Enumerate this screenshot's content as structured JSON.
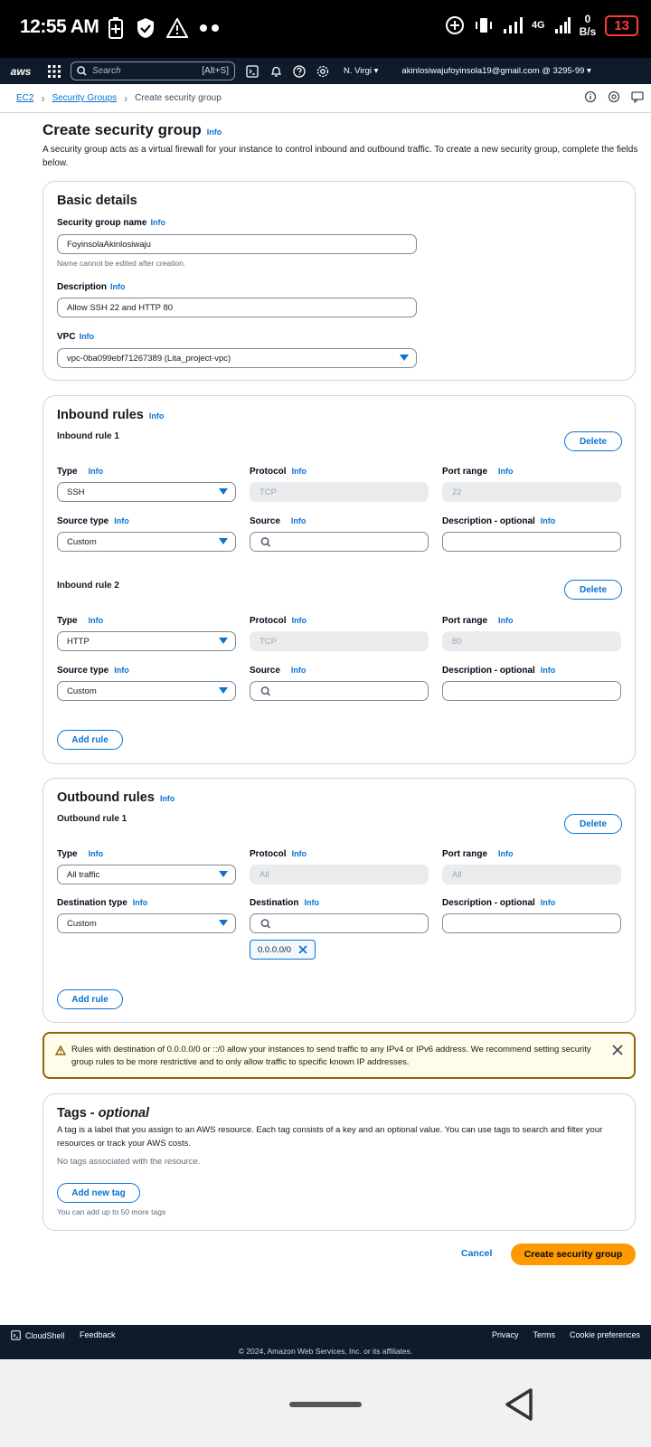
{
  "status_bar": {
    "time": "12:55 AM",
    "network": "4G",
    "speed_value": "0",
    "speed_unit": "B/s",
    "battery": "13"
  },
  "aws_nav": {
    "logo": "aws",
    "search_placeholder": "Search",
    "search_shortcut": "[Alt+S]",
    "region": "N. Virgi",
    "account": "akinlosiwajufoyinsola19@gmail.com @ 3295-99"
  },
  "breadcrumb": {
    "ec2": "EC2",
    "security_groups": "Security Groups",
    "current": "Create security group"
  },
  "page": {
    "title": "Create security group",
    "info": "Info",
    "description": "A security group acts as a virtual firewall for your instance to control inbound and outbound traffic. To create a new security group, complete the fields below."
  },
  "basic_details": {
    "title": "Basic details",
    "name_label": "Security group name",
    "name_value": "FoyinsolaAkinlosiwaju",
    "name_hint": "Name cannot be edited after creation.",
    "desc_label": "Description",
    "desc_value": "Allow SSH 22 and HTTP 80",
    "vpc_label": "VPC",
    "vpc_value": "vpc-0ba099ebf71267389 (Lita_project-vpc)"
  },
  "labels": {
    "info": "Info",
    "type": "Type",
    "protocol": "Protocol",
    "port_range": "Port range",
    "source_type": "Source type",
    "source": "Source",
    "description_optional": "Description - optional",
    "destination_type": "Destination type",
    "destination": "Destination",
    "delete": "Delete",
    "add_rule": "Add rule"
  },
  "inbound": {
    "title": "Inbound rules",
    "rules": [
      {
        "title": "Inbound rule 1",
        "type": "SSH",
        "protocol": "TCP",
        "port": "22",
        "source_type": "Custom"
      },
      {
        "title": "Inbound rule 2",
        "type": "HTTP",
        "protocol": "TCP",
        "port": "80",
        "source_type": "Custom"
      }
    ]
  },
  "outbound": {
    "title": "Outbound rules",
    "rule": {
      "title": "Outbound rule 1",
      "type": "All traffic",
      "protocol": "All",
      "port": "All",
      "destination_type": "Custom",
      "token": "0.0.0.0/0"
    }
  },
  "alert": {
    "text": "Rules with destination of 0.0.0.0/0 or ::/0 allow your instances to send traffic to any IPv4 or IPv6 address. We recommend setting security group rules to be more restrictive and to only allow traffic to specific known IP addresses."
  },
  "tags": {
    "title_main": "Tags - ",
    "title_em": "optional",
    "description": "A tag is a label that you assign to an AWS resource. Each tag consists of a key and an optional value. You can use tags to search and filter your resources or track your AWS costs.",
    "empty": "No tags associated with the resource.",
    "add_button": "Add new tag",
    "hint": "You can add up to 50 more tags"
  },
  "actions": {
    "cancel": "Cancel",
    "create": "Create security group"
  },
  "footer": {
    "cloudshell": "CloudShell",
    "feedback": "Feedback",
    "privacy": "Privacy",
    "terms": "Terms",
    "cookies": "Cookie preferences",
    "copyright": "© 2024, Amazon Web Services, Inc. or its affiliates."
  }
}
